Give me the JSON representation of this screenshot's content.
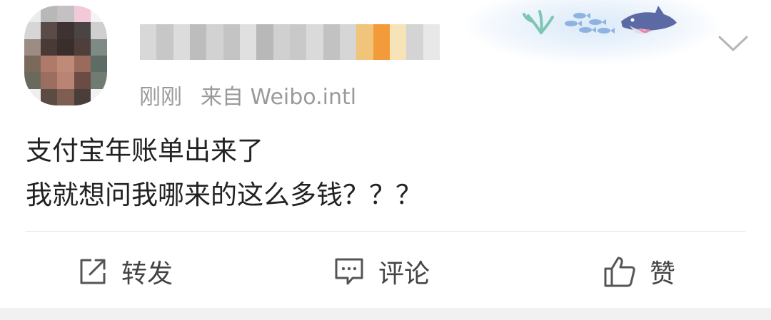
{
  "post": {
    "timestamp": "刚刚",
    "source": "来自 Weibo.intl",
    "lines": [
      "支付宝年账单出来了",
      "我就想问我哪来的这么多钱？？？"
    ]
  },
  "actions": {
    "repost_label": "转发",
    "comment_label": "评论",
    "like_label": "赞"
  },
  "icons": {
    "more": "chevron-down-icon",
    "repost": "share-box-arrow-icon",
    "comment": "speech-bubble-icon",
    "like": "thumbs-up-icon",
    "decoration": "shark-fish-coral-decoration"
  }
}
